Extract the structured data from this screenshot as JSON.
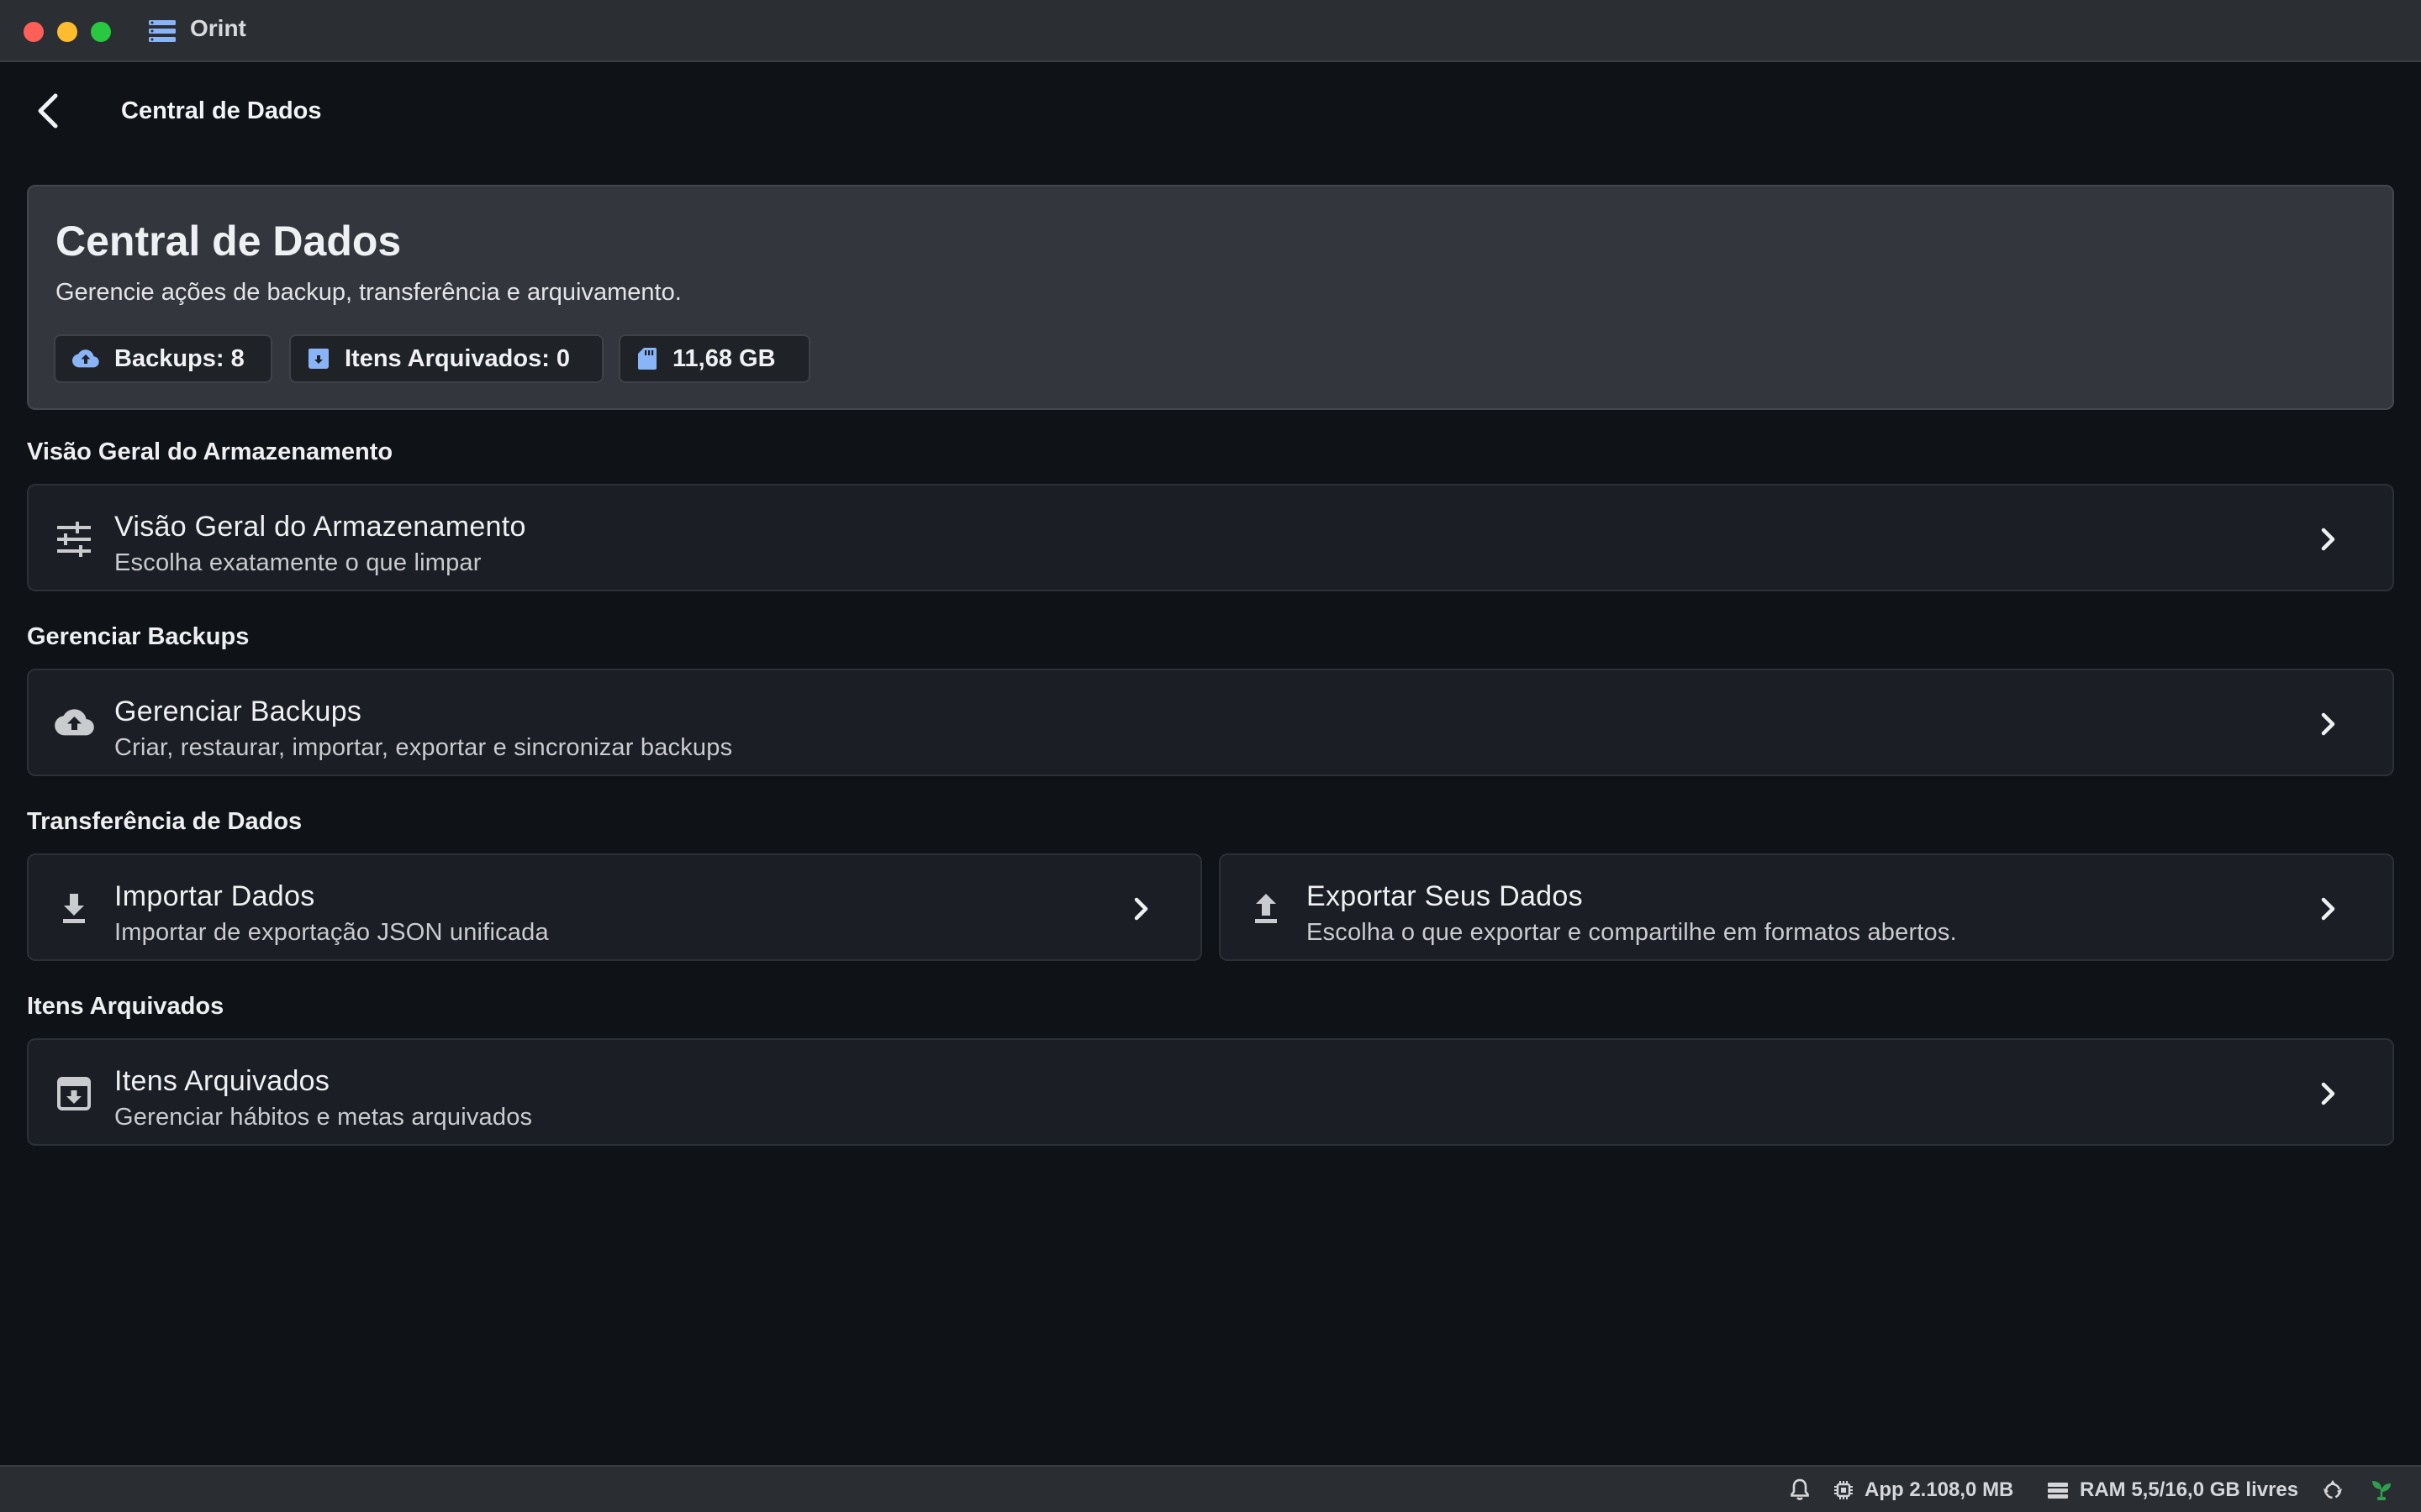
{
  "window": {
    "app_name": "Orint"
  },
  "header": {
    "title": "Central de Dados",
    "back_icon": "chevron-left-icon"
  },
  "hero": {
    "title": "Central de Dados",
    "subtitle": "Gerencie ações de backup, transferência e arquivamento.",
    "chips": [
      {
        "icon": "cloud-upload-icon",
        "label": "Backups: 8"
      },
      {
        "icon": "archive-icon",
        "label": "Itens Arquivados: 0"
      },
      {
        "icon": "sd-card-icon",
        "label": "11,68 GB"
      }
    ]
  },
  "sections": [
    {
      "label": "Visão Geral do Armazenamento",
      "cards": [
        {
          "icon": "tune-sliders-icon",
          "title": "Visão Geral do Armazenamento",
          "description": "Escolha exatamente o que limpar"
        }
      ]
    },
    {
      "label": "Gerenciar Backups",
      "cards": [
        {
          "icon": "cloud-upload-icon",
          "title": "Gerenciar Backups",
          "description": "Criar, restaurar, importar, exportar e sincronizar backups"
        }
      ]
    },
    {
      "label": "Transferência de Dados",
      "cards": [
        {
          "icon": "download-icon",
          "title": "Importar Dados",
          "description": "Importar de exportação JSON unificada"
        },
        {
          "icon": "upload-icon",
          "title": "Exportar Seus Dados",
          "description": "Escolha o que exportar e compartilhe em formatos abertos."
        }
      ]
    },
    {
      "label": "Itens Arquivados",
      "cards": [
        {
          "icon": "archive-box-icon",
          "title": "Itens Arquivados",
          "description": "Gerenciar hábitos e metas arquivados"
        }
      ]
    }
  ],
  "statusbar": {
    "app_memory": "App 2.108,0 MB",
    "ram": "RAM 5,5/16,0 GB livres",
    "icons": [
      "bell-icon",
      "cpu-icon",
      "memory-icon",
      "recycle-icon",
      "plant-icon"
    ]
  },
  "colors": {
    "accent": "#8ab4f8",
    "background": "#0f1217",
    "card": "#1b1e24",
    "hero": "#33363c"
  }
}
